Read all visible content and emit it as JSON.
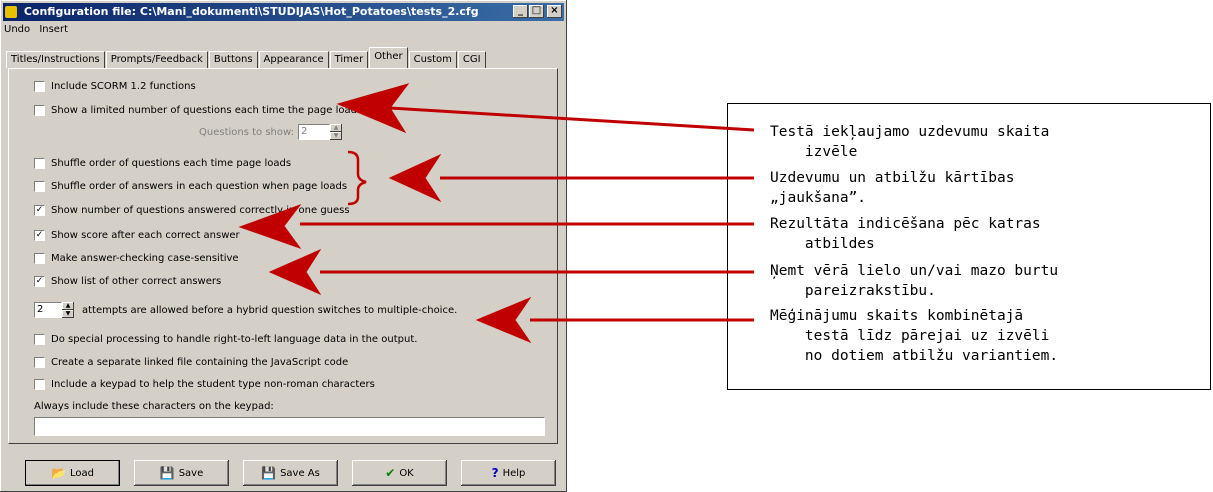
{
  "window": {
    "title": "Configuration file: C:\\Mani_dokumenti\\STUDIJAS\\Hot_Potatoes\\tests_2.cfg",
    "buttons": {
      "minimize": "_",
      "maximize": "□",
      "close": "×"
    }
  },
  "menu": {
    "undo": "Undo",
    "insert": "Insert"
  },
  "tabs": [
    "Titles/Instructions",
    "Prompts/Feedback",
    "Buttons",
    "Appearance",
    "Timer",
    "Other",
    "Custom",
    "CGI"
  ],
  "active_tab": "Other",
  "options": {
    "scorm": {
      "label": "Include SCORM 1.2 functions",
      "checked": false
    },
    "limited": {
      "label": "Show a limited number of questions each time the page loads",
      "checked": false
    },
    "questions_to_show": {
      "label": "Questions to show:",
      "value": "2"
    },
    "shuffle_questions": {
      "label": "Shuffle order of questions each time page loads",
      "checked": false
    },
    "shuffle_answers": {
      "label": "Shuffle order of answers in each question when page loads",
      "checked": false
    },
    "show_number": {
      "label": "Show number of questions answered correctly in one guess",
      "checked": true
    },
    "show_score": {
      "label": "Show score after each correct answer",
      "checked": true
    },
    "case_sensitive": {
      "label": "Make answer-checking case-sensitive",
      "checked": false
    },
    "show_list": {
      "label": "Show list of other correct answers",
      "checked": true
    },
    "attempts": {
      "value": "2",
      "label": "attempts are allowed before a hybrid question switches to multiple-choice."
    },
    "rtl": {
      "label": "Do special processing to handle right-to-left language data in the output.",
      "checked": false
    },
    "separate_js": {
      "label": "Create a separate linked file containing the JavaScript code",
      "checked": false
    },
    "keypad": {
      "label": "Include a keypad to help the student type non-roman characters",
      "checked": false
    },
    "keypad_chars": {
      "label": "Always include these characters on the keypad:",
      "value": ""
    }
  },
  "bottom_buttons": {
    "load": "Load",
    "save": "Save",
    "save_as": "Save As",
    "ok": "OK",
    "help": "Help"
  },
  "annotations": [
    "Testā iekļaujamo uzdevumu skaita\n    izvēle",
    "Uzdevumu un atbilžu kārtības\n„jaukšana”.",
    "Rezultāta indicēšana pēc katras\n    atbildes",
    "Ņemt vērā lielo un/vai mazo burtu\n    pareizrakstību.",
    "Mēģinājumu skaits kombinētajā\n    testā līdz pārejai uz izvēli\n    no dotiem atbilžu variantiem."
  ],
  "colors": {
    "arrow": "#c00000",
    "titlebar": "#0a246a",
    "face": "#d4d0c8"
  }
}
